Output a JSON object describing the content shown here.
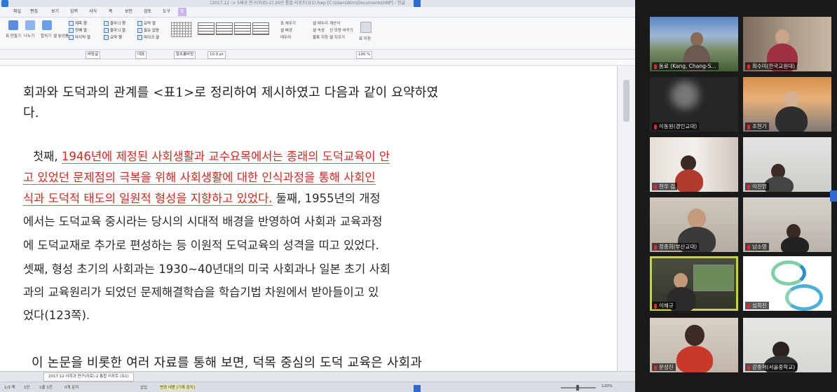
{
  "app": {
    "title": "[2017.12 -> 5재규 연구(자료)-2] 20년 통합 리포트(유1).hwp [C:\\Users\\Kim\\Documents\\HNP] - 한글",
    "menus": [
      "파일",
      "편집",
      "보기",
      "입력",
      "서식",
      "쪽",
      "보안",
      "검토",
      "도구",
      "표"
    ],
    "active_menu": "표"
  },
  "ribbon": {
    "groups": [
      "표 만들기",
      "나누기",
      "합치기",
      "셀 높이를",
      "표 속성"
    ],
    "checks": [
      "제목 행",
      "첫째 열",
      "마지막 열",
      "줄무늬 행",
      "줄무늬 열",
      "요약 행",
      "요약 열",
      "필요 없음",
      "마이크 셀"
    ],
    "right_items": [
      "표 채우기",
      "셀 배경",
      "테두리",
      "셀 테두리",
      "셀 속성",
      "블록 지정",
      "계산식",
      "선 모양 바꾸기",
      "셀 지우기"
    ],
    "right_button": "표 지정"
  },
  "formatbar": {
    "style": "바탕글",
    "lang": "대표",
    "font": "함초롬바탕",
    "size": "10.0 pt",
    "zoom": "100 %"
  },
  "document": {
    "line1": "회과와 도덕과의 관계를 <표1>로 정리하여 제시하였고 다음과 같이 요약하였",
    "line2": "다.",
    "q_intro": "첫째, ",
    "q_red1": "1946년에 제정된 사회생활과 교수요목에서는 종래의 도덕교육이 안",
    "q_red2": "고 있었던 문제점의 극복을 위해 사회생활에 대한 인식과정을 통해 사회인",
    "q_red3": "식과 도덕적 태도의 일원적 형성을 지향하고 있었다.",
    "q_black3": " 둘째, 1955년의 개정",
    "q_line4": "에서는 도덕교육 중시라는 당시의 시대적 배경을 반영하여 사회과 교육과정",
    "q_line5": "에 도덕교재로 추가로 편성하는 등 이원적 도덕교육의 성격을 띠고 있었다.",
    "q_line6": "셋째, 형성 초기의 사회과는 1930~40년대의 미국 사회과나 일본 초기 사회",
    "q_line7": "과의 교육원리가 되었던 문제해결학습을 학습기법 차원에서 받아들이고 있",
    "q_line8": "었다(123쪽).",
    "line_bottom": "이 논문을 비롯한 여러 자료를 통해 보면, 덕목 중심의 도덕 교육은 사회과"
  },
  "tabbar": {
    "tab_label": "2017.12 사회과 연구(자료)-2 통합 리포트 (유1)"
  },
  "statusbar": {
    "page": "1/3 쪽",
    "section": "1단",
    "line": "1줄 1칸",
    "chars": "0개 문자",
    "mode": "삽입",
    "track": "변경 내용 [기록 중지]",
    "zoom": "120%"
  },
  "participants": [
    {
      "name": "동료 (Kang, Chang-S..."
    },
    {
      "name": "최수미(한국교원대)"
    },
    {
      "name": "이동원(경인교대)"
    },
    {
      "name": "조현기"
    },
    {
      "name": "현우 김"
    },
    {
      "name": "이진영"
    },
    {
      "name": "정종희(부산교대)"
    },
    {
      "name": "남소영"
    },
    {
      "name": "이혜규"
    },
    {
      "name": "심희진"
    },
    {
      "name": "문성진"
    },
    {
      "name": "강종혁(서울중학교)"
    }
  ]
}
